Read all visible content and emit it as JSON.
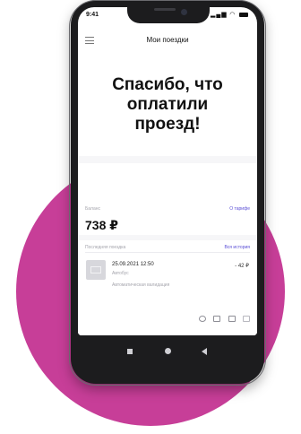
{
  "status_bar": {
    "time": "9:41",
    "signal_icons": "signal-wifi-battery"
  },
  "app_bar": {
    "title": "Мои поездки"
  },
  "hero": {
    "line1": "Спасибо, что",
    "line2": "оплатили",
    "line3": "проезд!"
  },
  "balance": {
    "label": "Баланс",
    "value": "738 ₽",
    "tariff_link": "О тарифе"
  },
  "trips": {
    "label": "Последняя поездка",
    "history_link": "Вся история",
    "last_trip": {
      "datetime": "25.09.2021 12:50",
      "transport": "Автобус",
      "method": "Автоматическая валидация",
      "amount": "- 42 ₽"
    }
  },
  "colors": {
    "accent": "#5b4fd6",
    "blob": "#c73e98",
    "phone_body": "#1c1c1e"
  }
}
